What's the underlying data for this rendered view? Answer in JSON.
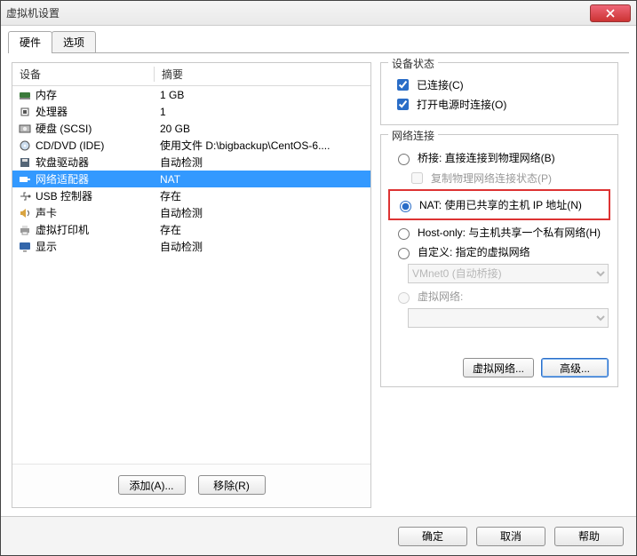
{
  "window": {
    "title": "虚拟机设置"
  },
  "tabs": {
    "hardware": "硬件",
    "options": "选项"
  },
  "columns": {
    "device": "设备",
    "summary": "摘要"
  },
  "devices": [
    {
      "icon": "memory",
      "name": "内存",
      "summary": "1 GB"
    },
    {
      "icon": "cpu",
      "name": "处理器",
      "summary": "1"
    },
    {
      "icon": "disk",
      "name": "硬盘 (SCSI)",
      "summary": "20 GB"
    },
    {
      "icon": "cd",
      "name": "CD/DVD (IDE)",
      "summary": "使用文件 D:\\bigbackup\\CentOS-6...."
    },
    {
      "icon": "floppy",
      "name": "软盘驱动器",
      "summary": "自动检测"
    },
    {
      "icon": "nic",
      "name": "网络适配器",
      "summary": "NAT",
      "selected": true
    },
    {
      "icon": "usb",
      "name": "USB 控制器",
      "summary": "存在"
    },
    {
      "icon": "sound",
      "name": "声卡",
      "summary": "自动检测"
    },
    {
      "icon": "printer",
      "name": "虚拟打印机",
      "summary": "存在"
    },
    {
      "icon": "display",
      "name": "显示",
      "summary": "自动检测"
    }
  ],
  "left_buttons": {
    "add": "添加(A)...",
    "remove": "移除(R)"
  },
  "status_group": {
    "legend": "设备状态",
    "connected": "已连接(C)",
    "connect_on_power": "打开电源时连接(O)"
  },
  "network_group": {
    "legend": "网络连接",
    "bridged": "桥接: 直接连接到物理网络(B)",
    "replicate": "复制物理网络连接状态(P)",
    "nat": "NAT: 使用已共享的主机 IP 地址(N)",
    "hostonly": "Host-only: 与主机共享一个私有网络(H)",
    "custom": "自定义: 指定的虚拟网络",
    "vmnet_placeholder": "VMnet0 (自动桥接)",
    "virtual_network": "虚拟网络:",
    "btn_vnet": "虚拟网络...",
    "btn_advanced": "高级..."
  },
  "footer": {
    "ok": "确定",
    "cancel": "取消",
    "help": "帮助"
  }
}
